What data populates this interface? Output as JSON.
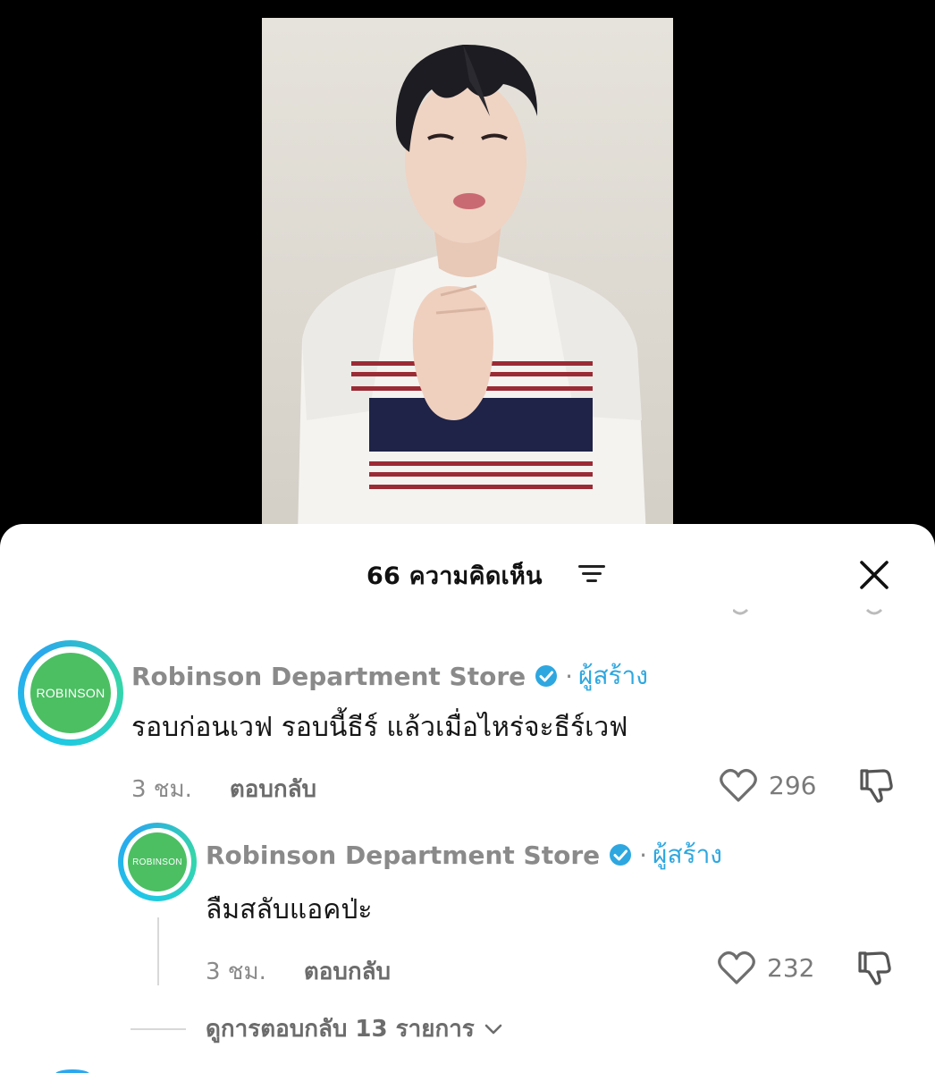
{
  "video": {
    "alt": ""
  },
  "comments_sheet": {
    "title": "66 ความคิดเห็น",
    "icons": {
      "sort": "sort-lines-icon",
      "close": "close-icon"
    }
  },
  "comments": [
    {
      "avatar_label": "ROBINSON",
      "author": "Robinson Department Store",
      "separator": "·",
      "creator_label": "ผู้สร้าง",
      "text": "รอบก่อนเวฟ รอบนี้ธีร์ แล้วเมื่อไหร่จะธีร์เวฟ",
      "time": "3 ชม.",
      "reply_label": "ตอบกลับ",
      "likes": "296"
    },
    {
      "avatar_label": "ROBINSON",
      "author": "Robinson Department Store",
      "separator": "·",
      "creator_label": "ผู้สร้าง",
      "text": "ลืมสลับแอคป่ะ",
      "time": "3 ชม.",
      "reply_label": "ตอบกลับ",
      "likes": "232"
    }
  ],
  "view_replies_label": "ดูการตอบกลับ 13 รายการ",
  "colors": {
    "brand_green": "#4cbf63",
    "verified_blue": "#2ea7e0",
    "muted_text": "#8a8a8a"
  }
}
